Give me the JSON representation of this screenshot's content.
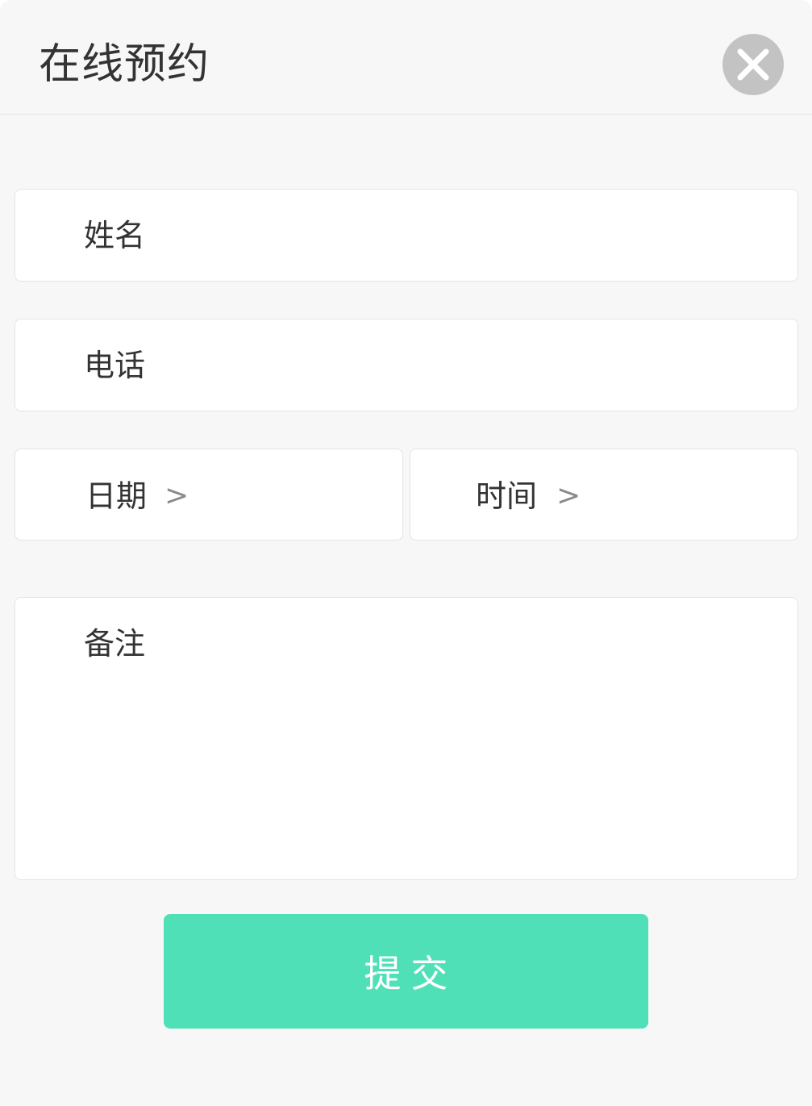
{
  "modal": {
    "title": "在线预约"
  },
  "form": {
    "name_label": "姓名",
    "phone_label": "电话",
    "date_label": "日期",
    "time_label": "时间",
    "chevron": ">",
    "note_label": "备注",
    "name_value": "",
    "phone_value": "",
    "note_value": ""
  },
  "submit": {
    "label": "提交"
  },
  "icons": {
    "close": "close-icon",
    "date_chevron": "chevron-right-icon",
    "time_chevron": "chevron-right-icon"
  },
  "colors": {
    "background": "#f7f7f7",
    "field_background": "#ffffff",
    "submit_accent": "#50e0b8",
    "close_button": "#c3c3c3",
    "text": "#333333"
  }
}
